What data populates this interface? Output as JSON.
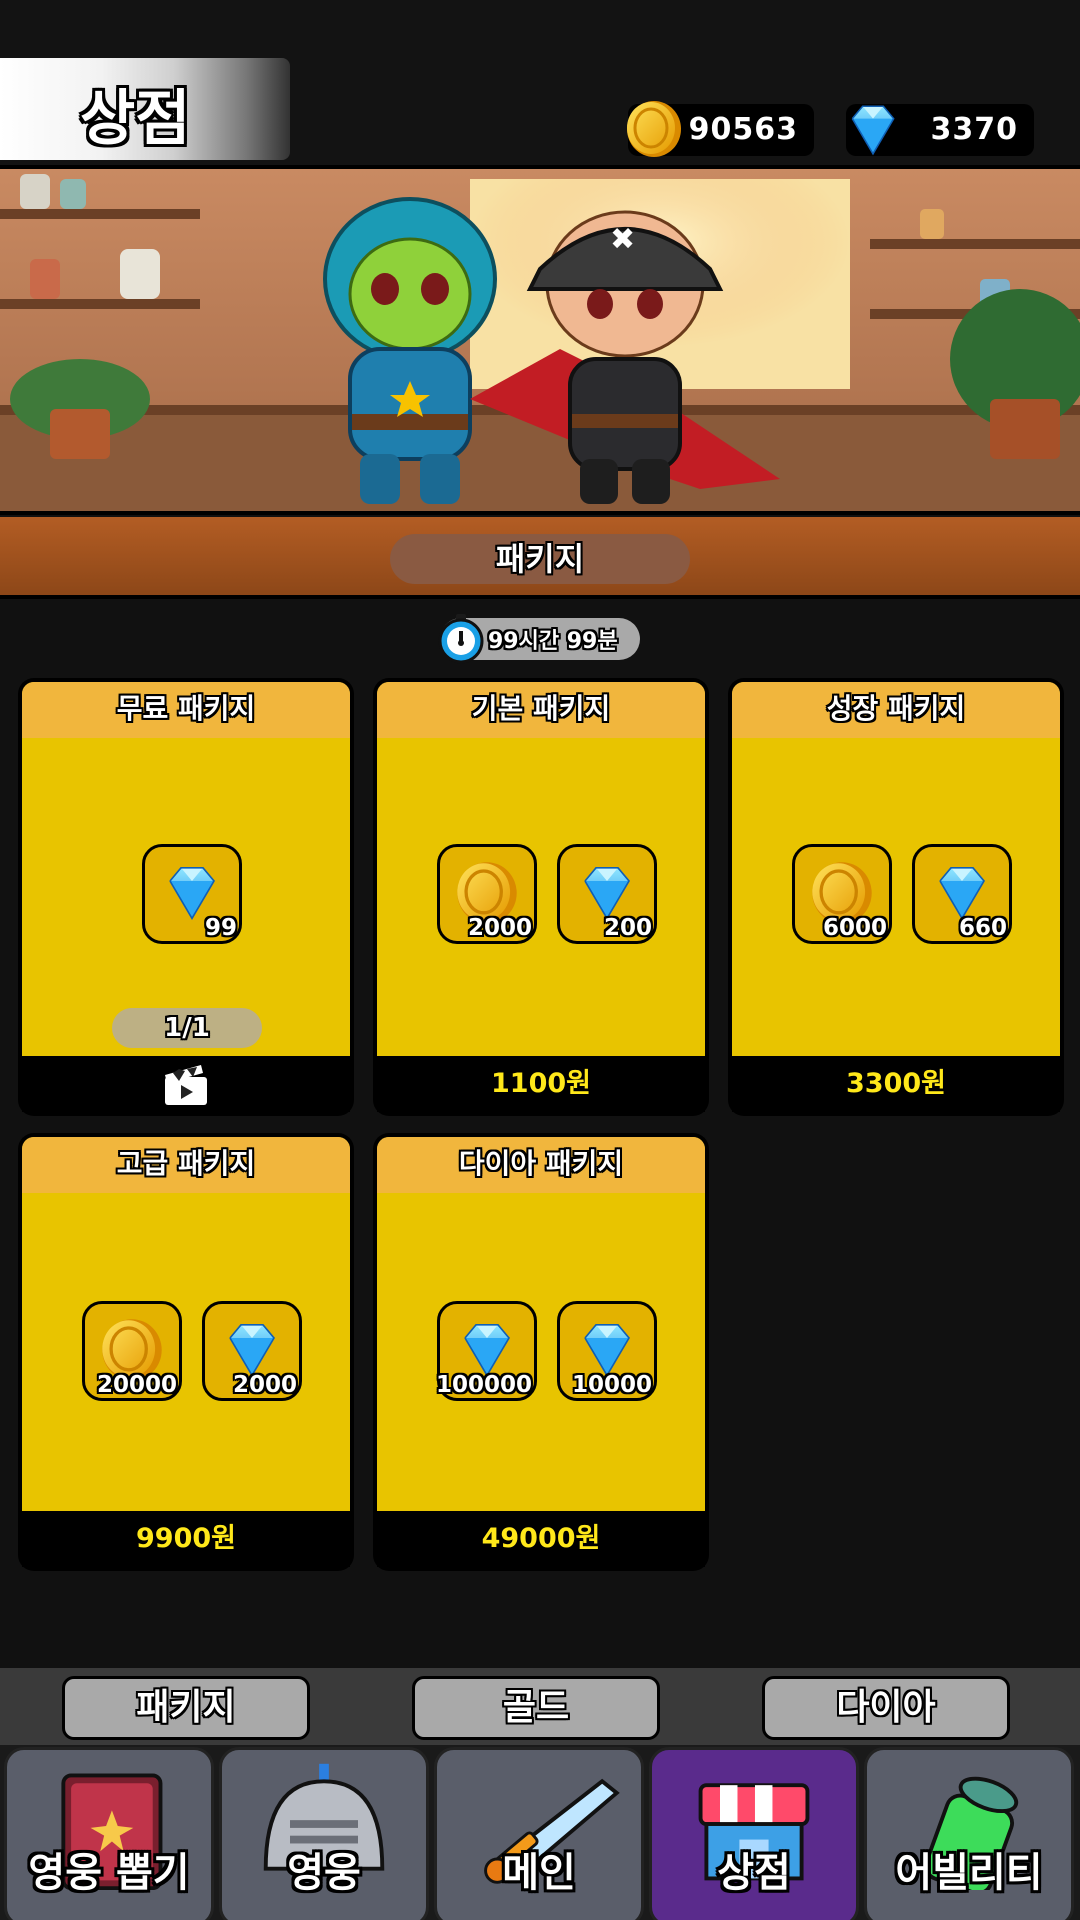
{
  "header": {
    "title": "상점",
    "gold": "90563",
    "diamond": "3370"
  },
  "section": {
    "title": "패키지",
    "timer": "99시간 99분"
  },
  "cards": [
    {
      "title": "무료 패키지",
      "items": [
        {
          "type": "diamond",
          "count": "99"
        }
      ],
      "limit": "1/1",
      "footer_icon": "video-ad-icon"
    },
    {
      "title": "기본 패키지",
      "items": [
        {
          "type": "gold",
          "count": "2000"
        },
        {
          "type": "diamond",
          "count": "200"
        }
      ],
      "price": "1100원"
    },
    {
      "title": "성장 패키지",
      "items": [
        {
          "type": "gold",
          "count": "6000"
        },
        {
          "type": "diamond",
          "count": "660"
        }
      ],
      "price": "3300원"
    },
    {
      "title": "고급 패키지",
      "items": [
        {
          "type": "gold",
          "count": "20000"
        },
        {
          "type": "diamond",
          "count": "2000"
        }
      ],
      "price": "9900원"
    },
    {
      "title": "다이아 패키지",
      "items": [
        {
          "type": "diamond",
          "count": "100000"
        },
        {
          "type": "diamond",
          "count": "10000"
        }
      ],
      "price": "49000원"
    }
  ],
  "subtabs": [
    "패키지",
    "골드",
    "다이아"
  ],
  "nav": [
    {
      "label": "영웅 뽑기",
      "icon": "spellbook-icon"
    },
    {
      "label": "영웅",
      "icon": "helmet-icon"
    },
    {
      "label": "메인",
      "icon": "sword-icon"
    },
    {
      "label": "상점",
      "icon": "shop-icon",
      "active": true
    },
    {
      "label": "어빌리티",
      "icon": "potion-icon"
    }
  ],
  "colors": {
    "card_body": "#e8c400",
    "card_header": "#f1b63d",
    "price": "#ffe81a",
    "section_bar": "#a4531f",
    "nav_active": "#5a2b8c"
  }
}
